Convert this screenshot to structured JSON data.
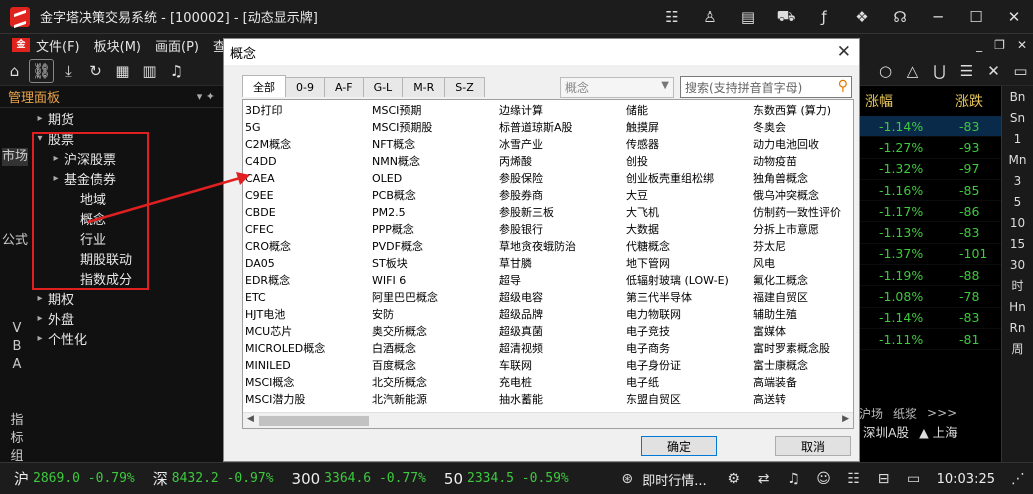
{
  "window": {
    "title": "金字塔决策交易系统 - [100002] - [动态显示牌]"
  },
  "menu": {
    "items": [
      "文件(F)",
      "板块(M)",
      "画面(P)",
      "查询"
    ],
    "window_controls": [
      "_",
      "❐",
      "✕"
    ]
  },
  "left_panel": {
    "title": "管理面板",
    "side_tabs": [
      "市场",
      "公式",
      "VBA",
      "指标组"
    ],
    "tree": [
      {
        "label": "期货",
        "level": 0,
        "arrow": "▸"
      },
      {
        "label": "股票",
        "level": 0,
        "arrow": "▾"
      },
      {
        "label": "沪深股票",
        "level": 1,
        "arrow": "▸"
      },
      {
        "label": "基金债券",
        "level": 1,
        "arrow": "▸"
      },
      {
        "label": "地域",
        "level": 2,
        "arrow": ""
      },
      {
        "label": "概念",
        "level": 2,
        "arrow": ""
      },
      {
        "label": "行业",
        "level": 2,
        "arrow": ""
      },
      {
        "label": "期股联动",
        "level": 2,
        "arrow": ""
      },
      {
        "label": "指数成分",
        "level": 2,
        "arrow": ""
      },
      {
        "label": "期权",
        "level": 0,
        "arrow": "▸"
      },
      {
        "label": "外盘",
        "level": 0,
        "arrow": "▸"
      },
      {
        "label": "个性化",
        "level": 0,
        "arrow": "▸"
      }
    ]
  },
  "market": {
    "headers": [
      "涨幅",
      "涨跌"
    ],
    "rows": [
      {
        "pct": "-1.14%",
        "chg": "-83"
      },
      {
        "pct": "-1.27%",
        "chg": "-93"
      },
      {
        "pct": "-1.32%",
        "chg": "-97"
      },
      {
        "pct": "-1.16%",
        "chg": "-85"
      },
      {
        "pct": "-1.17%",
        "chg": "-86"
      },
      {
        "pct": "-1.13%",
        "chg": "-83"
      },
      {
        "pct": "-1.37%",
        "chg": "-101"
      },
      {
        "pct": "-1.19%",
        "chg": "-88"
      },
      {
        "pct": "-1.08%",
        "chg": "-78"
      },
      {
        "pct": "-1.14%",
        "chg": "-83"
      },
      {
        "pct": "-1.11%",
        "chg": "-81"
      }
    ],
    "tabs_row1": [
      "沪场",
      "纸浆",
      ">>>"
    ],
    "tabs_row2": [
      "深圳A股",
      "▲ 上海"
    ]
  },
  "rail": [
    "Bn",
    "Sn",
    "1",
    "Mn",
    "3",
    "5",
    "10",
    "15",
    "30",
    "时",
    "Hn",
    "Rn",
    "周"
  ],
  "dialog": {
    "title": "概念",
    "tabs": [
      "全部",
      "0-9",
      "A-F",
      "G-L",
      "M-R",
      "S-Z"
    ],
    "category_select": "概念",
    "search_placeholder": "搜索(支持拼音首字母)",
    "columns": [
      [
        "3D打印",
        "5G",
        "C2M概念",
        "C4DD",
        "CAEA",
        "C9EE",
        "CBDE",
        "CFEC",
        "CRO概念",
        "DA05",
        "EDR概念",
        "ETC",
        "HJT电池",
        "MCU芯片",
        "MICROLED概念",
        "MINILED",
        "MSCI概念",
        "MSCI潜力股"
      ],
      [
        "MSCI预期",
        "MSCI预期股",
        "NFT概念",
        "NMN概念",
        "OLED",
        "PCB概念",
        "PM2.5",
        "PPP概念",
        "PVDF概念",
        "ST板块",
        "WIFI 6",
        "阿里巴巴概念",
        "安防",
        "奥交所概念",
        "白酒概念",
        "百度概念",
        "北交所概念",
        "北汽新能源"
      ],
      [
        "边缘计算",
        "标普道琼斯A股",
        "冰雪产业",
        "丙烯酸",
        "参股保险",
        "参股券商",
        "参股新三板",
        "参股银行",
        "草地贪夜蛾防治",
        "草甘膦",
        "超导",
        "超级电容",
        "超级品牌",
        "超级真菌",
        "超清视频",
        "车联网",
        "充电桩",
        "抽水蓄能"
      ],
      [
        "储能",
        "触摸屏",
        "传感器",
        "创投",
        "创业板壳重组松绑",
        "大豆",
        "大飞机",
        "大数据",
        "代糖概念",
        "地下管网",
        "低辐射玻璃 (LOW-E)",
        "第三代半导体",
        "电力物联网",
        "电子竞技",
        "电子商务",
        "电子身份证",
        "电子纸",
        "东盟自贸区"
      ],
      [
        "东数西算 (算力)",
        "冬奥会",
        "动力电池回收",
        "动物疫苗",
        "独角兽概念",
        "俄乌冲突概念",
        "仿制药一致性评价",
        "分拆上市意愿",
        "芬太尼",
        "风电",
        "氟化工概念",
        "福建自贸区",
        "辅助生殖",
        "富媒体",
        "富时罗素概念股",
        "富士康概念",
        "高端装备",
        "高送转"
      ]
    ],
    "ok_label": "确定",
    "cancel_label": "取消"
  },
  "statusbar": {
    "indices": [
      {
        "name": "沪",
        "value": "2869.0 -0.79%"
      },
      {
        "name": "深",
        "value": "8432.2 -0.97%"
      },
      {
        "name": "300",
        "value": "3364.6 -0.77%"
      },
      {
        "name": "50",
        "value": "2334.5 -0.59%"
      }
    ],
    "news_label": "即时行情...",
    "time": "10:03:25"
  },
  "colors": {
    "down": "#3ec93e",
    "accent": "#e8a34a",
    "annotation": "#e02020"
  }
}
